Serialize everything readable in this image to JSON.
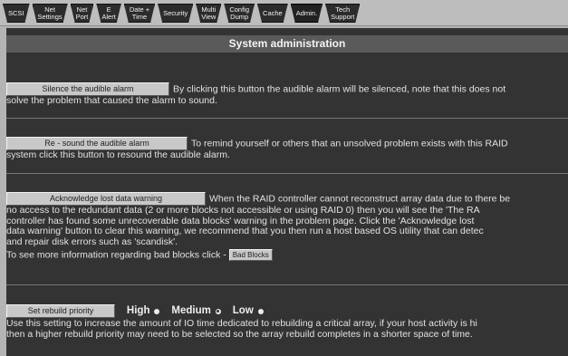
{
  "tabs": [
    {
      "label": "SCSI"
    },
    {
      "label": "Net\nSettings"
    },
    {
      "label": "Net\nPort"
    },
    {
      "label": "E\nAlert"
    },
    {
      "label": "Date +\nTime"
    },
    {
      "label": "Security"
    },
    {
      "label": "Multi\nView"
    },
    {
      "label": "Config\nDump"
    },
    {
      "label": "Cache"
    },
    {
      "label": "Admin."
    },
    {
      "label": "Tech\nSupport"
    }
  ],
  "active_tab": "Admin.",
  "page": {
    "title": "System administration"
  },
  "sections": {
    "silence": {
      "button": "Silence the audible alarm",
      "line1": "By clicking this button the audible alarm will be silenced, note that this does not",
      "line2": "solve the problem that caused the alarm to sound."
    },
    "resound": {
      "button": "Re - sound the audible alarm",
      "line1": "To remind yourself or others that an unsolved problem exists with this RAID",
      "line2": "system click this button to resound the audible alarm."
    },
    "acknowledge": {
      "button": "Acknowledge lost data warning",
      "line1": "When the RAID controller cannot reconstruct array data due to there be",
      "line2": "no access to the redundant data (2 or more blocks not accessible or using RAID 0) then you will see the 'The RA",
      "line3": "controller has found some unrecoverable data blocks' warning in the problem page. Click the 'Acknowledge lost",
      "line4": "data warning' button to clear this warning, we recommend that you then run a host based OS utility that can detec",
      "line5": "and repair disk errors such as 'scandisk'.",
      "bad_blocks_text": "To see more information regarding bad blocks click -",
      "bad_blocks_button": "Bad Blocks"
    },
    "rebuild": {
      "button": "Set rebuild priority",
      "options": [
        "High",
        "Medium",
        "Low"
      ],
      "selected": "Medium",
      "line1": "Use this setting to increase the amount of IO time dedicated to rebuilding a critical array, if your host activity is hi",
      "line2": "then a higher rebuild priority may need to be selected so the array rebuild completes in a shorter space of time."
    }
  }
}
